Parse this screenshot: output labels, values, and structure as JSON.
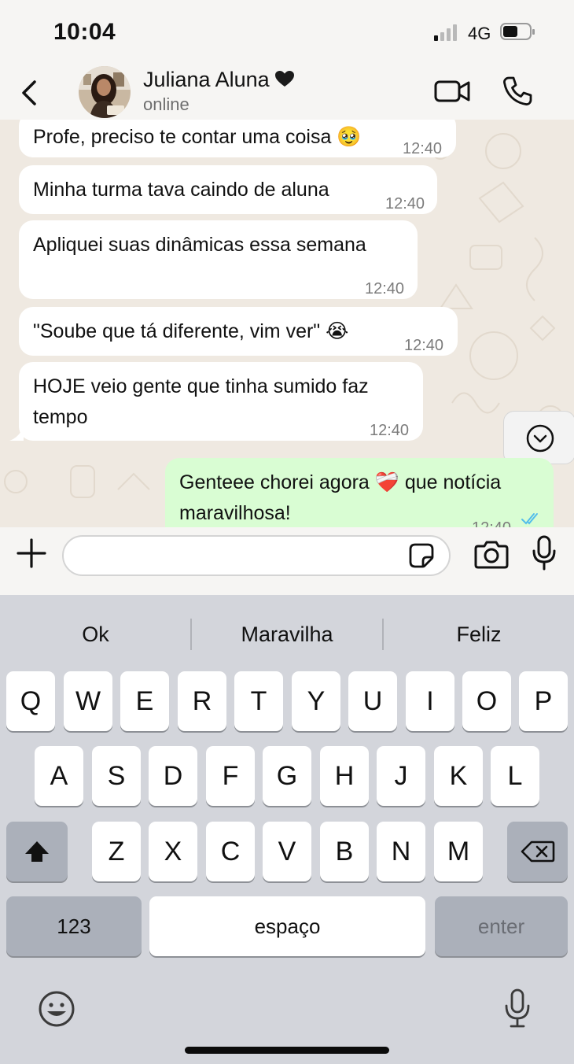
{
  "status_bar": {
    "time": "10:04",
    "network": "4G"
  },
  "header": {
    "contact_name": "Juliana Aluna",
    "contact_status": "online"
  },
  "messages": [
    {
      "text": "Profe, preciso te contar uma coisa 🥹",
      "time": "12:40",
      "direction": "in"
    },
    {
      "text": "Minha turma tava caindo de aluna",
      "time": "12:40",
      "direction": "in"
    },
    {
      "text": "Apliquei suas dinâmicas essa semana",
      "time": "12:40",
      "direction": "in"
    },
    {
      "text": "\"Soube que tá diferente, vim ver\" 😭",
      "time": "12:40",
      "direction": "in"
    },
    {
      "text_line1": "HOJE veio gente que tinha sumido faz",
      "text_line2": "tempo",
      "time": "12:40",
      "direction": "in"
    },
    {
      "text_line1": "Genteee chorei agora ❤️‍🩹 que notícia",
      "text_line2": "maravilhosa!",
      "time": "12:40",
      "direction": "out",
      "status": "read"
    }
  ],
  "input": {
    "placeholder": ""
  },
  "keyboard": {
    "suggestions": [
      "Ok",
      "Maravilha",
      "Feliz"
    ],
    "row1": [
      "Q",
      "W",
      "E",
      "R",
      "T",
      "Y",
      "U",
      "I",
      "O",
      "P"
    ],
    "row2": [
      "A",
      "S",
      "D",
      "F",
      "G",
      "H",
      "J",
      "K",
      "L"
    ],
    "row3": [
      "Z",
      "X",
      "C",
      "V",
      "B",
      "N",
      "M"
    ],
    "numbers_label": "123",
    "space_label": "espaço",
    "enter_label": "enter"
  },
  "colors": {
    "outgoing_bubble": "#d9fdd3",
    "incoming_bubble": "#ffffff",
    "chat_background": "#efe9e1",
    "read_ticks": "#53bdeb"
  },
  "icons": {
    "back": "chevron-left-icon",
    "video": "video-camera-icon",
    "call": "phone-icon",
    "attach": "plus-icon",
    "sticker": "sticker-icon",
    "camera": "camera-icon",
    "mic": "microphone-icon",
    "scroll_down": "chevron-down-icon",
    "shift": "shift-icon",
    "backspace": "backspace-icon",
    "emoji": "emoji-icon",
    "dictation": "dictation-icon"
  }
}
